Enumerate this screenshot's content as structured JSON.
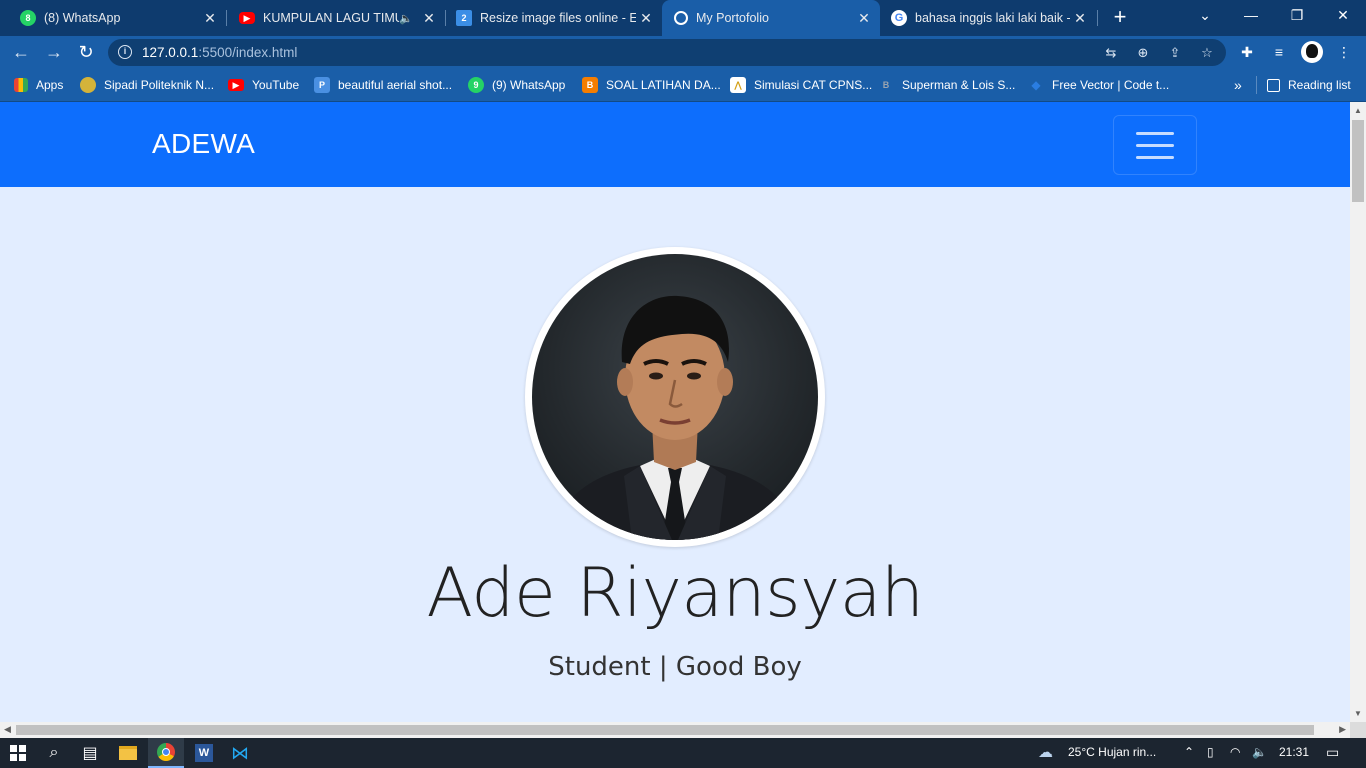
{
  "tabs": [
    {
      "title": "(8) WhatsApp",
      "icon": "whatsapp-icon",
      "icon_color": "#25d366",
      "badge": "8"
    },
    {
      "title": "KUMPULAN LAGU TIMUR",
      "icon": "youtube-icon",
      "icon_color": "#ff0000"
    },
    {
      "title": "Resize image files online - Ed",
      "icon": "resize-icon",
      "icon_color": "#3b8ee6",
      "badge": "2"
    },
    {
      "title": "My Portofolio",
      "icon": "globe-icon",
      "icon_color": "#ffffff"
    },
    {
      "title": "bahasa inggis laki laki baik -",
      "icon": "google-icon",
      "icon_color": "#ffffff"
    }
  ],
  "active_tab": "My Portofolio",
  "omnibox": {
    "host": "127.0.0.1",
    "path": ":5500/index.html"
  },
  "bookmarks": [
    {
      "label": "Apps",
      "icon": "apps-grid-icon"
    },
    {
      "label": "Sipadi Politeknik N...",
      "icon": "polytechnic-icon"
    },
    {
      "label": "YouTube",
      "icon": "youtube-icon"
    },
    {
      "label": "beautiful aerial shot...",
      "icon": "pexels-icon"
    },
    {
      "label": "(9) WhatsApp",
      "icon": "whatsapp-icon"
    },
    {
      "label": "SOAL LATIHAN DA...",
      "icon": "blogger-icon"
    },
    {
      "label": "Simulasi CAT CPNS...",
      "icon": "cat-cpns-icon"
    },
    {
      "label": "Superman & Lois S...",
      "icon": "bookmark-b-icon"
    },
    {
      "label": "Free Vector | Code t...",
      "icon": "freepik-icon"
    }
  ],
  "reading_list": "Reading list",
  "page": {
    "brand": "ADEWA",
    "name": "Ade Riyansyah",
    "tagline": "Student | Good Boy",
    "navbar_color": "#0d6efd",
    "background_color": "#e2edff"
  },
  "taskbar": {
    "weather": "25°C  Hujan rin...",
    "time": "21:31"
  }
}
